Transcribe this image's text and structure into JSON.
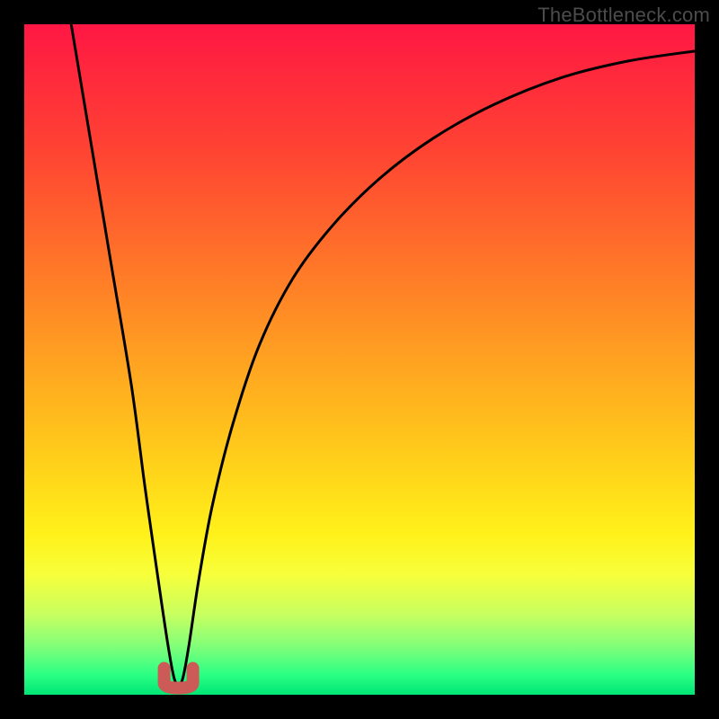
{
  "watermark": "TheBottleneck.com",
  "chart_data": {
    "type": "line",
    "title": "",
    "xlabel": "",
    "ylabel": "",
    "xlim": [
      0,
      100
    ],
    "ylim": [
      0,
      100
    ],
    "grid": false,
    "series": [
      {
        "name": "bottleneck-curve",
        "color": "#000000",
        "x": [
          7,
          10,
          13,
          16,
          18,
          20,
          21.5,
          22.5,
          23.5,
          24.5,
          26,
          28,
          31,
          35,
          40,
          46,
          53,
          61,
          70,
          80,
          90,
          100
        ],
        "values": [
          100,
          82,
          64,
          46,
          31,
          17,
          7,
          2,
          2,
          7,
          17,
          28,
          40,
          52,
          62,
          70,
          77,
          83,
          88,
          92,
          94.5,
          96
        ]
      }
    ],
    "marker": {
      "name": "optimal-point",
      "color": "#cc5a57",
      "shape": "U",
      "x": 23,
      "y": 1
    }
  },
  "colors": {
    "frame": "#000000",
    "gradient_top": "#ff1744",
    "gradient_mid": "#ffd21a",
    "gradient_bottom": "#00e676",
    "curve": "#000000",
    "marker": "#cc5a57",
    "watermark": "#4c4c4c"
  }
}
